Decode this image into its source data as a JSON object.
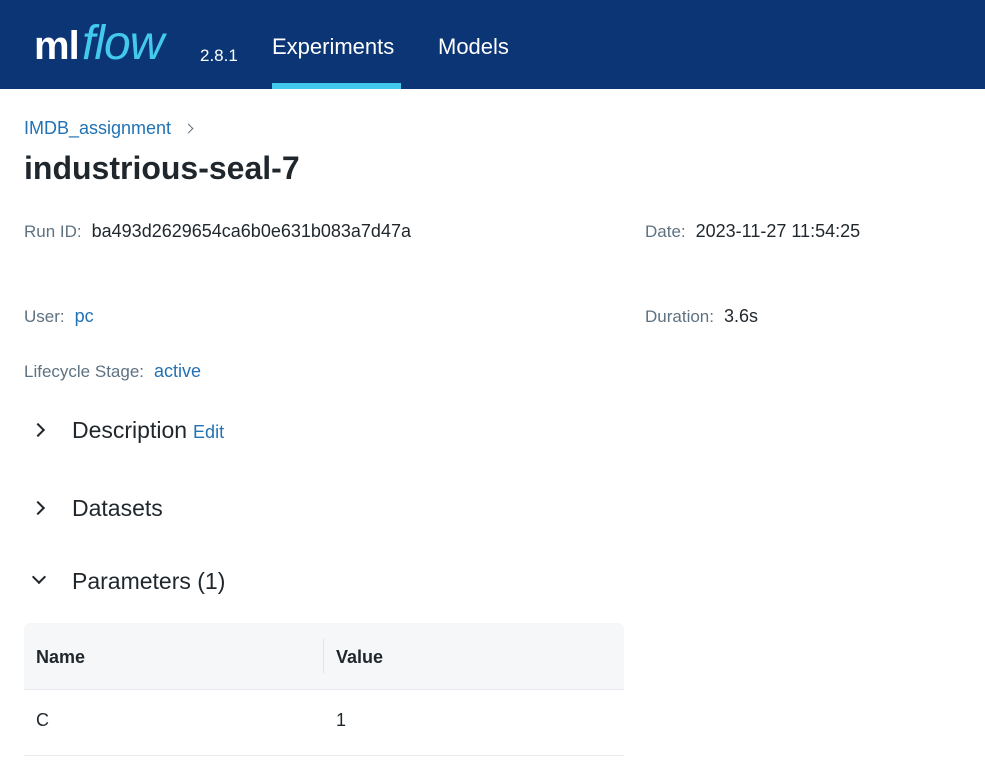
{
  "header": {
    "logo_ml": "ml",
    "logo_flow": "flow",
    "version": "2.8.1",
    "nav": [
      {
        "label": "Experiments",
        "active": true
      },
      {
        "label": "Models",
        "active": false
      }
    ],
    "colors": {
      "background": "#0b3574",
      "accent": "#43c9ed"
    }
  },
  "breadcrumb": {
    "experiment": "IMDB_assignment"
  },
  "run": {
    "title": "industrious-seal-7",
    "run_id_label": "Run ID:",
    "run_id": "ba493d2629654ca6b0e631b083a7d47a",
    "date_label": "Date:",
    "date": "2023-11-27 11:54:25",
    "user_label": "User:",
    "user": "pc",
    "duration_label": "Duration:",
    "duration": "3.6s",
    "lifecycle_label": "Lifecycle Stage:",
    "lifecycle": "active"
  },
  "sections": {
    "description": {
      "title": "Description",
      "edit": "Edit",
      "expanded": false
    },
    "datasets": {
      "title": "Datasets",
      "expanded": false
    },
    "parameters": {
      "title": "Parameters (1)",
      "expanded": true
    }
  },
  "parameters_table": {
    "columns": [
      "Name",
      "Value"
    ],
    "rows": [
      {
        "name": "C",
        "value": "1"
      }
    ]
  },
  "icons": [
    "chevron-right-icon",
    "chevron-down-icon"
  ]
}
